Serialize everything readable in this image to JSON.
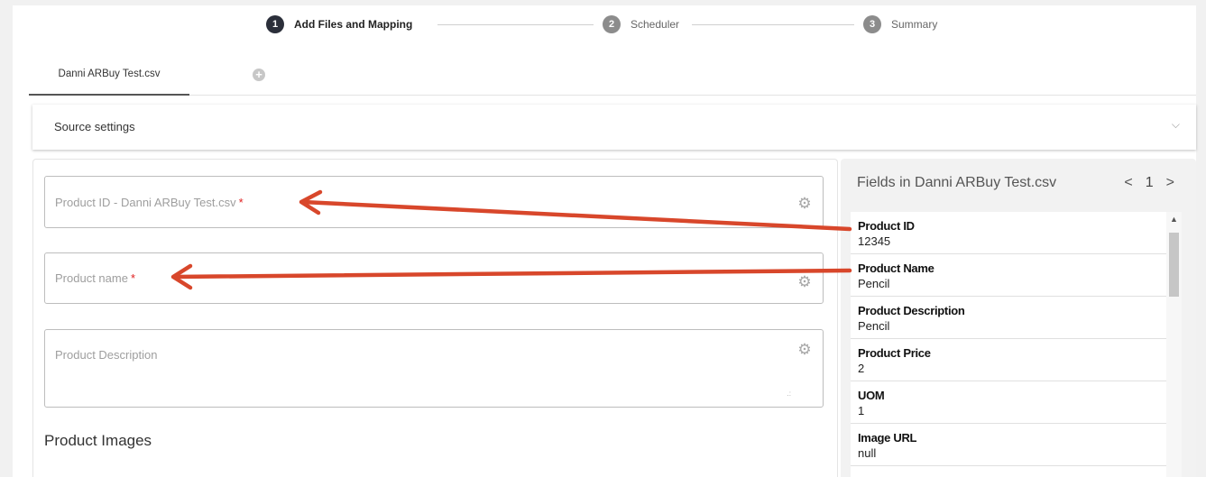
{
  "stepper": {
    "steps": [
      {
        "num": "1",
        "label": "Add Files and Mapping"
      },
      {
        "num": "2",
        "label": "Scheduler"
      },
      {
        "num": "3",
        "label": "Summary"
      }
    ]
  },
  "tabs": {
    "file_tab": "Danni ARBuy Test.csv",
    "add_icon": "+"
  },
  "source_settings": {
    "title": "Source settings",
    "chevron": "⌵"
  },
  "form": {
    "fields": [
      {
        "placeholder": "Product ID - Danni ARBuy Test.csv",
        "required": "*"
      },
      {
        "placeholder": "Product name",
        "required": "*"
      },
      {
        "placeholder": "Product Description",
        "required": ""
      }
    ],
    "section_title": "Product Images",
    "gear_icon": "⚙",
    "resize_icon": ".:"
  },
  "fields_panel": {
    "title": "Fields in Danni ARBuy Test.csv",
    "prev": "<",
    "page": "1",
    "next": ">",
    "items": [
      {
        "key": "Product ID",
        "value": "12345"
      },
      {
        "key": "Product Name",
        "value": "Pencil"
      },
      {
        "key": "Product Description",
        "value": "Pencil"
      },
      {
        "key": "Product Price",
        "value": "2"
      },
      {
        "key": "UOM",
        "value": "1"
      },
      {
        "key": "Image URL",
        "value": "null"
      }
    ],
    "scroll_up": "▲"
  },
  "colors": {
    "arrow": "#d8472b",
    "step_active": "#2b2f3a",
    "step_inactive": "#8c8c8c",
    "required": "#e02020"
  }
}
